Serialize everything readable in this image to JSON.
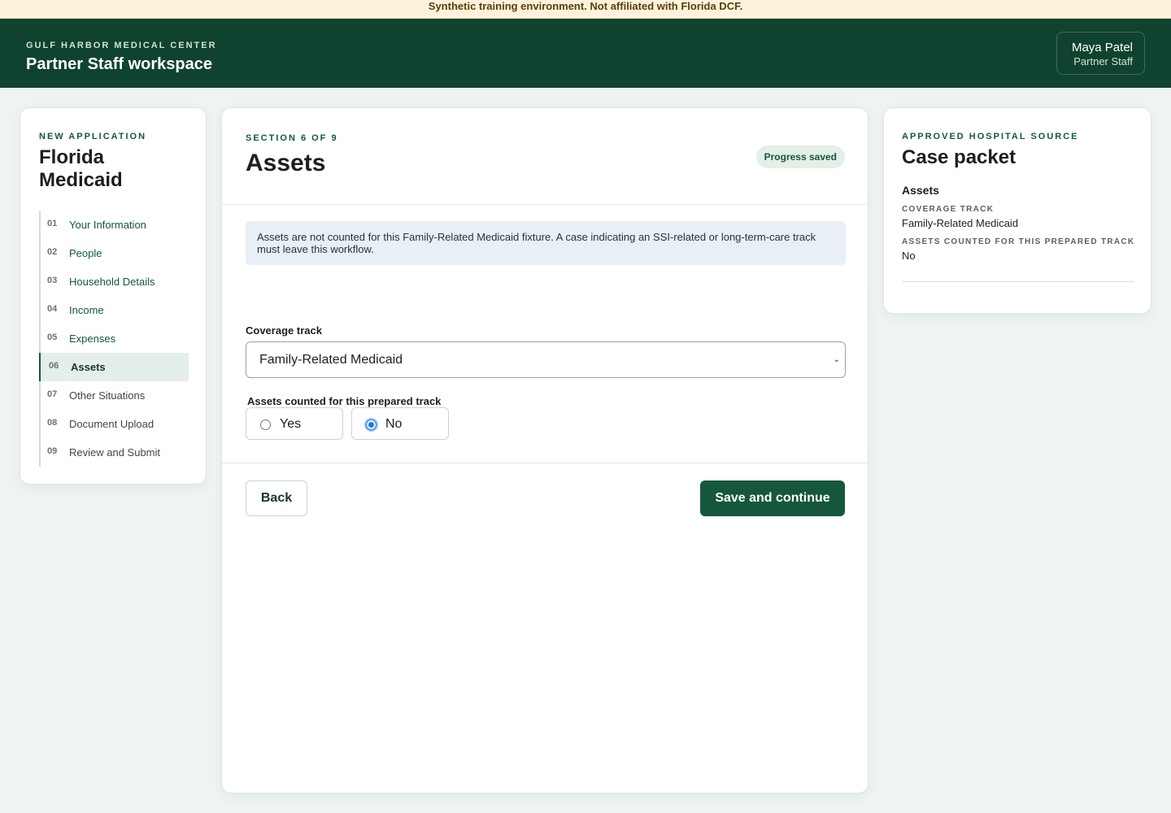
{
  "banner": "Synthetic training environment. Not affiliated with Florida DCF.",
  "header": {
    "org": "GULF HARBOR MEDICAL CENTER",
    "workspace": "Partner Staff workspace",
    "user_name": "Maya Patel",
    "user_role": "Partner Staff"
  },
  "sidebar": {
    "eyebrow": "NEW APPLICATION",
    "title": "Florida Medicaid",
    "steps": [
      {
        "num": "01",
        "label": "Your Information"
      },
      {
        "num": "02",
        "label": "People"
      },
      {
        "num": "03",
        "label": "Household Details"
      },
      {
        "num": "04",
        "label": "Income"
      },
      {
        "num": "05",
        "label": "Expenses"
      },
      {
        "num": "06",
        "label": "Assets"
      },
      {
        "num": "07",
        "label": "Other Situations"
      },
      {
        "num": "08",
        "label": "Document Upload"
      },
      {
        "num": "09",
        "label": "Review and Submit"
      }
    ],
    "active_step": "06"
  },
  "main": {
    "eyebrow": "SECTION 6 OF 9",
    "title": "Assets",
    "status_badge": "Progress saved",
    "info": "Assets are not counted for this Family-Related Medicaid fixture. A case indicating an SSI-related or long-term-care track must leave this workflow.",
    "coverage_label": "Coverage track",
    "coverage_value": "Family-Related Medicaid",
    "assets_label": "Assets counted for this prepared track",
    "options": [
      {
        "label": "Yes",
        "checked": false
      },
      {
        "label": "No",
        "checked": true
      }
    ],
    "back_label": "Back",
    "save_label": "Save and continue"
  },
  "packet": {
    "eyebrow": "APPROVED HOSPITAL SOURCE",
    "title": "Case packet",
    "section": "Assets",
    "fields": [
      {
        "key": "COVERAGE TRACK",
        "value": "Family-Related Medicaid"
      },
      {
        "key": "ASSETS COUNTED FOR THIS PREPARED TRACK",
        "value": "No"
      }
    ]
  },
  "colors": {
    "header_bg": "#10432f",
    "accent": "#15573d",
    "banner_bg": "#fdf3dc",
    "page_bg": "#eff4f1",
    "radio_selected": "#1a73e8"
  },
  "icons": {
    "select_chevron": "chevron-down-icon"
  }
}
